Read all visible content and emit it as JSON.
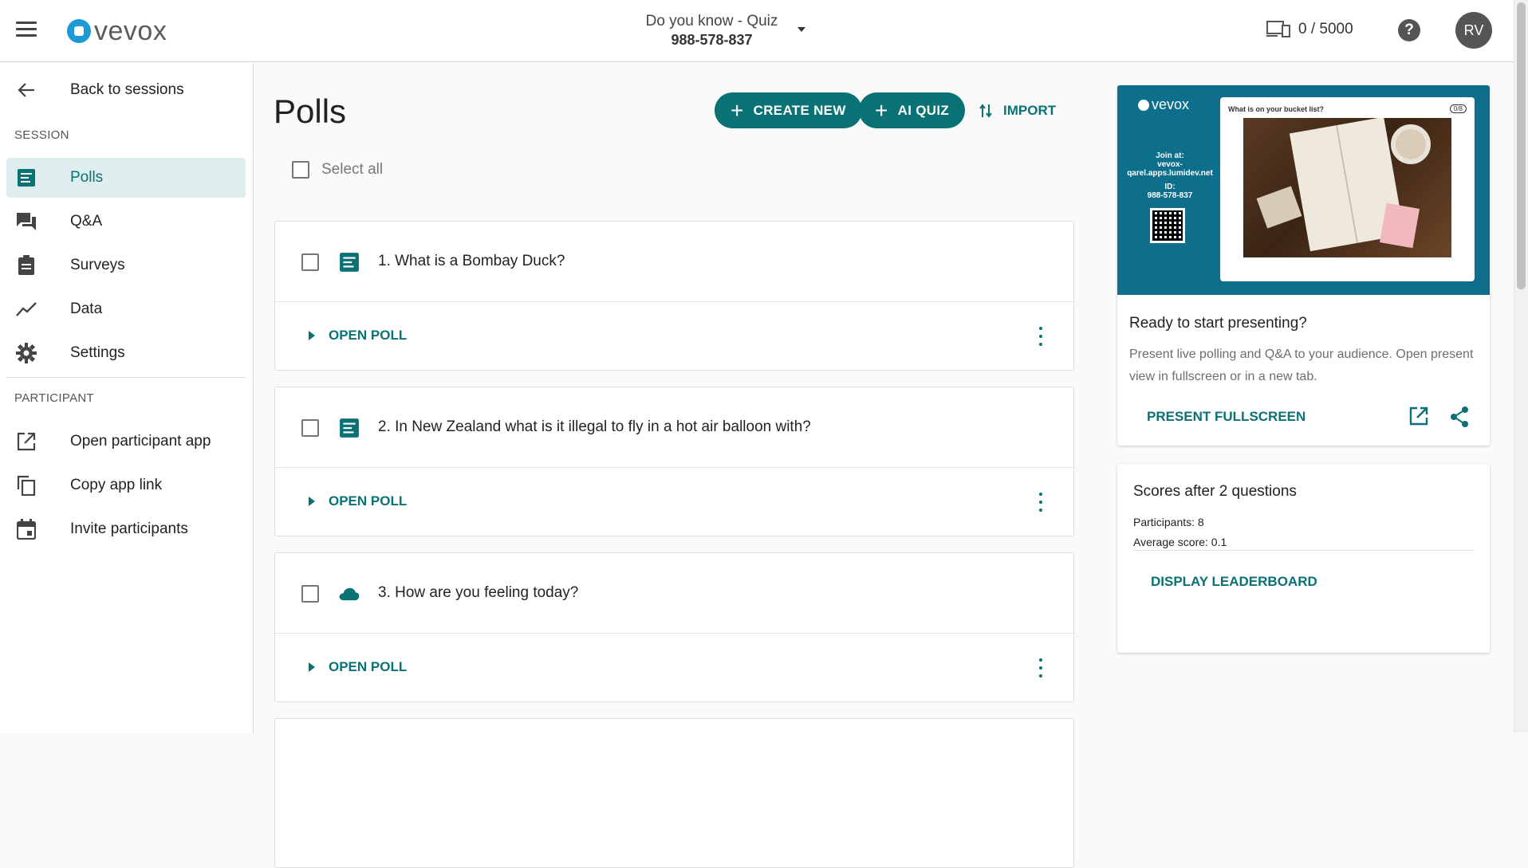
{
  "header": {
    "logo_text": "vevox",
    "session_name": "Do you know - Quiz",
    "session_id": "988-578-837",
    "capacity": "0 / 5000",
    "help_label": "?",
    "avatar_initials": "RV"
  },
  "sidebar": {
    "back_label": "Back to sessions",
    "session_header": "SESSION",
    "participant_header": "PARTICIPANT",
    "session_items": [
      {
        "label": "Polls",
        "icon": "poll-icon",
        "active": true
      },
      {
        "label": "Q&A",
        "icon": "forum-icon"
      },
      {
        "label": "Surveys",
        "icon": "clipboard-icon"
      },
      {
        "label": "Data",
        "icon": "trend-icon"
      },
      {
        "label": "Settings",
        "icon": "gear-icon"
      }
    ],
    "participant_items": [
      {
        "label": "Open participant app",
        "icon": "open-external-icon"
      },
      {
        "label": "Copy app link",
        "icon": "copy-icon"
      },
      {
        "label": "Invite participants",
        "icon": "calendar-icon"
      }
    ]
  },
  "main": {
    "title": "Polls",
    "create_new_label": "CREATE NEW",
    "ai_quiz_label": "AI QUIZ",
    "import_label": "IMPORT",
    "select_all_label": "Select all",
    "polls": [
      {
        "title": "1. What is a Bombay Duck?",
        "type_icon": "text-poll-icon",
        "action": "OPEN POLL"
      },
      {
        "title": "2. In New Zealand what is it illegal to fly in a hot air balloon with?",
        "type_icon": "text-poll-icon",
        "action": "OPEN POLL"
      },
      {
        "title": "3. How are you feeling today?",
        "type_icon": "word-cloud-icon",
        "action": "OPEN POLL"
      }
    ]
  },
  "present": {
    "preview": {
      "logo": "vevox",
      "join_at": "Join at:",
      "join_url": "vevox-qarel.apps.lumidev.net",
      "id_label": "ID:",
      "id_value": "988-578-837",
      "question": "What is on your bucket list?",
      "count": "0/8"
    },
    "title": "Ready to start presenting?",
    "description": "Present live polling and Q&A to your audience. Open present view in fullscreen or in a new tab.",
    "fullscreen_label": "PRESENT FULLSCREEN"
  },
  "scores": {
    "title": "Scores after 2 questions",
    "participants": "Participants: 8",
    "average": "Average score: 0.1",
    "leaderboard_label": "DISPLAY LEADERBOARD"
  },
  "colors": {
    "accent": "#0a7174",
    "active_bg": "#deeeee",
    "preview_bg": "#0e6f8c"
  }
}
